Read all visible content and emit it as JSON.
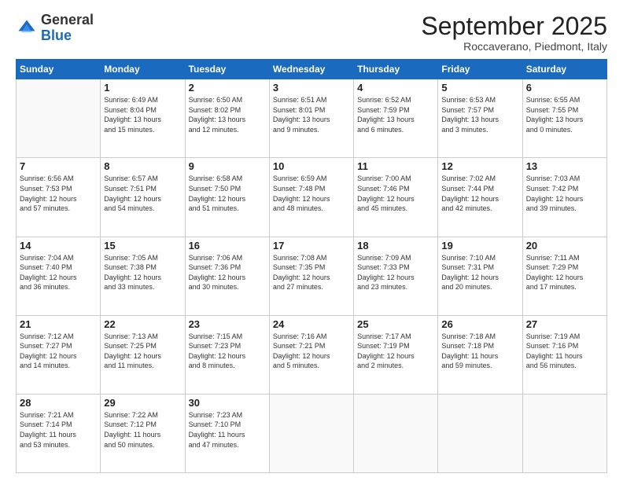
{
  "header": {
    "logo": {
      "general": "General",
      "blue": "Blue"
    },
    "title": "September 2025",
    "subtitle": "Roccaverano, Piedmont, Italy"
  },
  "calendar": {
    "weekdays": [
      "Sunday",
      "Monday",
      "Tuesday",
      "Wednesday",
      "Thursday",
      "Friday",
      "Saturday"
    ],
    "weeks": [
      [
        {
          "day": "",
          "info": ""
        },
        {
          "day": "1",
          "info": "Sunrise: 6:49 AM\nSunset: 8:04 PM\nDaylight: 13 hours\nand 15 minutes."
        },
        {
          "day": "2",
          "info": "Sunrise: 6:50 AM\nSunset: 8:02 PM\nDaylight: 13 hours\nand 12 minutes."
        },
        {
          "day": "3",
          "info": "Sunrise: 6:51 AM\nSunset: 8:01 PM\nDaylight: 13 hours\nand 9 minutes."
        },
        {
          "day": "4",
          "info": "Sunrise: 6:52 AM\nSunset: 7:59 PM\nDaylight: 13 hours\nand 6 minutes."
        },
        {
          "day": "5",
          "info": "Sunrise: 6:53 AM\nSunset: 7:57 PM\nDaylight: 13 hours\nand 3 minutes."
        },
        {
          "day": "6",
          "info": "Sunrise: 6:55 AM\nSunset: 7:55 PM\nDaylight: 13 hours\nand 0 minutes."
        }
      ],
      [
        {
          "day": "7",
          "info": "Sunrise: 6:56 AM\nSunset: 7:53 PM\nDaylight: 12 hours\nand 57 minutes."
        },
        {
          "day": "8",
          "info": "Sunrise: 6:57 AM\nSunset: 7:51 PM\nDaylight: 12 hours\nand 54 minutes."
        },
        {
          "day": "9",
          "info": "Sunrise: 6:58 AM\nSunset: 7:50 PM\nDaylight: 12 hours\nand 51 minutes."
        },
        {
          "day": "10",
          "info": "Sunrise: 6:59 AM\nSunset: 7:48 PM\nDaylight: 12 hours\nand 48 minutes."
        },
        {
          "day": "11",
          "info": "Sunrise: 7:00 AM\nSunset: 7:46 PM\nDaylight: 12 hours\nand 45 minutes."
        },
        {
          "day": "12",
          "info": "Sunrise: 7:02 AM\nSunset: 7:44 PM\nDaylight: 12 hours\nand 42 minutes."
        },
        {
          "day": "13",
          "info": "Sunrise: 7:03 AM\nSunset: 7:42 PM\nDaylight: 12 hours\nand 39 minutes."
        }
      ],
      [
        {
          "day": "14",
          "info": "Sunrise: 7:04 AM\nSunset: 7:40 PM\nDaylight: 12 hours\nand 36 minutes."
        },
        {
          "day": "15",
          "info": "Sunrise: 7:05 AM\nSunset: 7:38 PM\nDaylight: 12 hours\nand 33 minutes."
        },
        {
          "day": "16",
          "info": "Sunrise: 7:06 AM\nSunset: 7:36 PM\nDaylight: 12 hours\nand 30 minutes."
        },
        {
          "day": "17",
          "info": "Sunrise: 7:08 AM\nSunset: 7:35 PM\nDaylight: 12 hours\nand 27 minutes."
        },
        {
          "day": "18",
          "info": "Sunrise: 7:09 AM\nSunset: 7:33 PM\nDaylight: 12 hours\nand 23 minutes."
        },
        {
          "day": "19",
          "info": "Sunrise: 7:10 AM\nSunset: 7:31 PM\nDaylight: 12 hours\nand 20 minutes."
        },
        {
          "day": "20",
          "info": "Sunrise: 7:11 AM\nSunset: 7:29 PM\nDaylight: 12 hours\nand 17 minutes."
        }
      ],
      [
        {
          "day": "21",
          "info": "Sunrise: 7:12 AM\nSunset: 7:27 PM\nDaylight: 12 hours\nand 14 minutes."
        },
        {
          "day": "22",
          "info": "Sunrise: 7:13 AM\nSunset: 7:25 PM\nDaylight: 12 hours\nand 11 minutes."
        },
        {
          "day": "23",
          "info": "Sunrise: 7:15 AM\nSunset: 7:23 PM\nDaylight: 12 hours\nand 8 minutes."
        },
        {
          "day": "24",
          "info": "Sunrise: 7:16 AM\nSunset: 7:21 PM\nDaylight: 12 hours\nand 5 minutes."
        },
        {
          "day": "25",
          "info": "Sunrise: 7:17 AM\nSunset: 7:19 PM\nDaylight: 12 hours\nand 2 minutes."
        },
        {
          "day": "26",
          "info": "Sunrise: 7:18 AM\nSunset: 7:18 PM\nDaylight: 11 hours\nand 59 minutes."
        },
        {
          "day": "27",
          "info": "Sunrise: 7:19 AM\nSunset: 7:16 PM\nDaylight: 11 hours\nand 56 minutes."
        }
      ],
      [
        {
          "day": "28",
          "info": "Sunrise: 7:21 AM\nSunset: 7:14 PM\nDaylight: 11 hours\nand 53 minutes."
        },
        {
          "day": "29",
          "info": "Sunrise: 7:22 AM\nSunset: 7:12 PM\nDaylight: 11 hours\nand 50 minutes."
        },
        {
          "day": "30",
          "info": "Sunrise: 7:23 AM\nSunset: 7:10 PM\nDaylight: 11 hours\nand 47 minutes."
        },
        {
          "day": "",
          "info": ""
        },
        {
          "day": "",
          "info": ""
        },
        {
          "day": "",
          "info": ""
        },
        {
          "day": "",
          "info": ""
        }
      ]
    ]
  }
}
